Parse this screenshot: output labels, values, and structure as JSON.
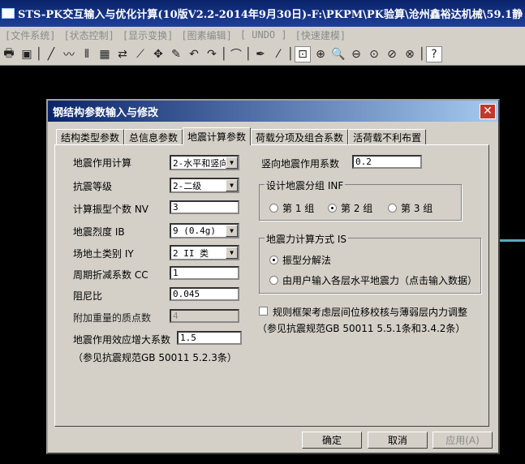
{
  "app": {
    "title": "STS-PK交互输入与优化计算(10版V2.2-2014年9月30日)-F:\\PKPM\\PK验算\\沧州鑫裕达机械\\59.1静"
  },
  "menu": [
    "[文件系统]",
    "[状态控制]",
    "[显示变换]",
    "[图素编辑]",
    "[  UNDO  ]",
    "[快速建模]"
  ],
  "toolbar": {
    "icons": [
      "print-icon",
      "save-icon",
      "sep",
      "line-icon",
      "polyline-icon",
      "parallel-lines-icon",
      "grid-icon",
      "move-icon",
      "rotate-icon",
      "cross-icon",
      "pencil-icon",
      "undo-icon",
      "redo-icon",
      "sep",
      "arc-icon",
      "sep",
      "pen-icon",
      "brush-icon",
      "sep",
      "select-window-icon",
      "zoom-area-icon",
      "zoom-in-icon",
      "zoom-out-icon",
      "zoom-magnify-icon",
      "zoom-reduce-icon",
      "zoom-all-icon",
      "sep",
      "help-icon"
    ]
  },
  "dialog": {
    "title": "钢结构参数输入与修改",
    "tabs": [
      "结构类型参数",
      "总信息参数",
      "地震计算参数",
      "荷载分项及组合系数",
      "活荷载不利布置"
    ],
    "active_tab": "地震计算参数",
    "left": {
      "seismic_calc": {
        "label": "地震作用计算",
        "value": "2-水平和竖向"
      },
      "seismic_grade": {
        "label": "抗震等级",
        "value": "2-二级"
      },
      "modes": {
        "label": "计算振型个数 NV",
        "value": "3"
      },
      "intensity": {
        "label": "地震烈度 IB",
        "value": "9  (0.4g)"
      },
      "site_class": {
        "label": "场地土类别 IY",
        "value": "2  II 类"
      },
      "period_factor": {
        "label": "周期折减系数 CC",
        "value": "1"
      },
      "damping": {
        "label": "阻尼比",
        "value": "0.045"
      },
      "added_mass": {
        "label": "附加重量的质点数",
        "value": "4"
      },
      "amplify": {
        "label": "地震作用效应增大系数",
        "value": "1.5"
      },
      "note": "（参见抗震规范GB 50011 5.2.3条）"
    },
    "right": {
      "vertical_factor": {
        "label": "竖向地震作用系数",
        "value": "0.2"
      },
      "group": {
        "title": "设计地震分组 INF",
        "options": [
          "第 1 组",
          "第 2 组",
          "第 3 组"
        ],
        "selected": "第 2 组"
      },
      "method": {
        "title": "地震力计算方式 IS",
        "options": [
          "振型分解法",
          "由用户输入各层水平地震力（点击输入数据）"
        ],
        "selected": "振型分解法"
      },
      "check": {
        "label": "规则框架考虑层间位移校核与薄弱层内力调整",
        "checked": false
      },
      "check_note": "（参见抗震规范GB 50011 5.5.1条和3.4.2条）"
    },
    "buttons": {
      "ok": "确定",
      "cancel": "取消",
      "apply": "应用(A)"
    }
  }
}
